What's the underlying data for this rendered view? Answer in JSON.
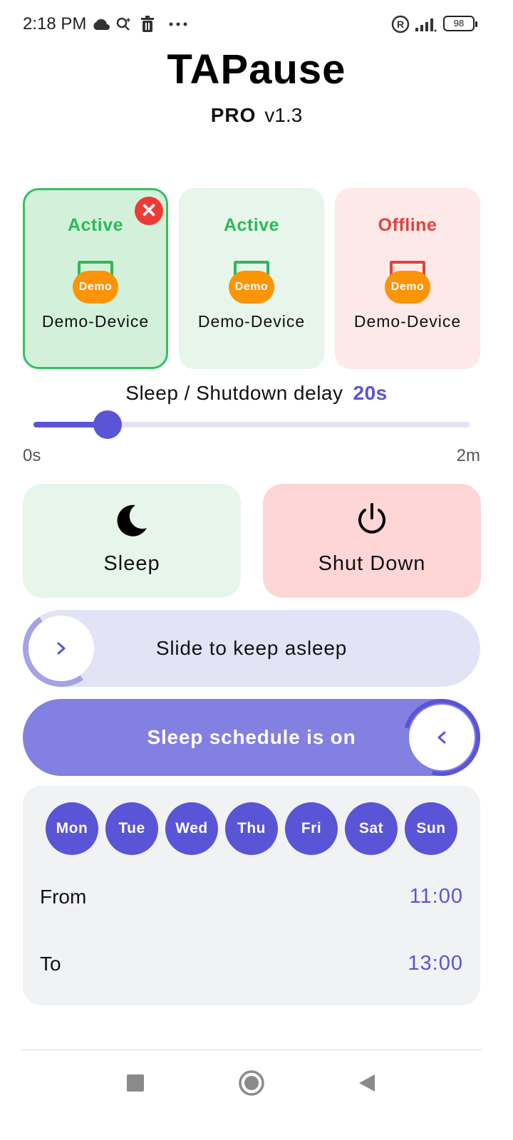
{
  "status_bar": {
    "time": "2:18 PM",
    "icons": [
      "cloud-icon",
      "magic-search-icon",
      "trash-icon",
      "more-icon",
      "registered-icon",
      "signal-icon",
      "battery-icon"
    ],
    "battery": "98"
  },
  "header": {
    "title": "TAPause",
    "edition": "PRO",
    "version": "v1.3"
  },
  "devices": [
    {
      "status": "Active",
      "badge": "Demo",
      "name": "Demo-Device",
      "selected": true,
      "status_color": "#2fb85a"
    },
    {
      "status": "Active",
      "badge": "Demo",
      "name": "Demo-Device",
      "selected": false,
      "status_color": "#2fb85a"
    },
    {
      "status": "Offline",
      "badge": "Demo",
      "name": "Demo-Device",
      "selected": false,
      "status_color": "#e6403b"
    }
  ],
  "delay": {
    "label": "Sleep / Shutdown delay",
    "value": "20s",
    "min_label": "0s",
    "max_label": "2m",
    "fraction": 0.17
  },
  "actions": {
    "sleep_label": "Sleep",
    "shutdown_label": "Shut Down"
  },
  "slide_keep_asleep": {
    "label": "Slide to keep asleep"
  },
  "schedule": {
    "toggle_label": "Sleep schedule is on",
    "days": [
      "Mon",
      "Tue",
      "Wed",
      "Thu",
      "Fri",
      "Sat",
      "Sun"
    ],
    "from_label": "From",
    "from_value": "11:00",
    "to_label": "To",
    "to_value": "13:00"
  },
  "colors": {
    "accent": "#5a54d6",
    "active_green": "#2fb85a",
    "offline_red": "#e6403b",
    "demo_orange": "#fb9407"
  },
  "nav": [
    "recent-apps-icon",
    "home-icon",
    "back-icon"
  ]
}
